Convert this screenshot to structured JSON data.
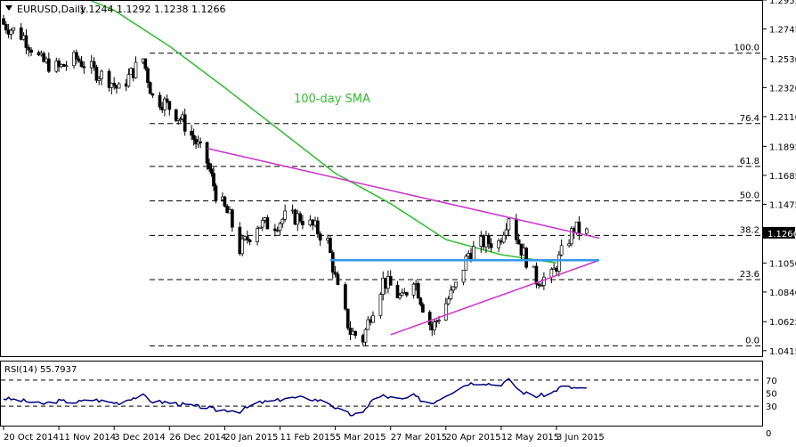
{
  "header": {
    "symbol": "EURUSD,Daily",
    "ohlc": "1.1244 1.1292 1.1238 1.1266"
  },
  "colors": {
    "bull": "#ffffff",
    "bear": "#000000",
    "sma": "#33bb33",
    "trendline": "#cc33cc",
    "support": "#3399ee",
    "fib": "#000000",
    "rsi": "#000080",
    "price_tag_bg": "#000000",
    "price_tag_fg": "#ffffff"
  },
  "chart_data": [
    {
      "type": "candlestick",
      "title": "EURUSD,Daily",
      "ylim": [
        1.0375,
        1.2955
      ],
      "y_ticks": [
        "1.2955",
        "1.2745",
        "1.2530",
        "1.2320",
        "1.2110",
        "1.1895",
        "1.1685",
        "1.1475",
        "1.1266",
        "1.1050",
        "1.0840",
        "1.0625",
        "1.0415"
      ],
      "x_ticks": [
        "20 Oct 2014",
        "11 Nov 2014",
        "3 Dec 2014",
        "26 Dec 2014",
        "20 Jan 2015",
        "11 Feb 2015",
        "5 Mar 2015",
        "27 Mar 2015",
        "20 Apr 2015",
        "12 May 2015",
        "3 Jun 2015"
      ],
      "current_price": "1.1266",
      "annotation": "100-day SMA",
      "close_path": [
        [
          "20 Oct 2014",
          1.278
        ],
        [
          "28 Oct 2014",
          1.269
        ],
        [
          "4 Nov 2014",
          1.251
        ],
        [
          "11 Nov 2014",
          1.246
        ],
        [
          "18 Nov 2014",
          1.253
        ],
        [
          "25 Nov 2014",
          1.244
        ],
        [
          "1 Dec 2014",
          1.238
        ],
        [
          "5 Dec 2014",
          1.23
        ],
        [
          "10 Dec 2014",
          1.242
        ],
        [
          "15 Dec 2014",
          1.253
        ],
        [
          "19 Dec 2014",
          1.225
        ],
        [
          "24 Dec 2014",
          1.221
        ],
        [
          "31 Dec 2014",
          1.21
        ],
        [
          "6 Jan 2015",
          1.195
        ],
        [
          "12 Jan 2015",
          1.178
        ],
        [
          "16 Jan 2015",
          1.156
        ],
        [
          "22 Jan 2015",
          1.138
        ],
        [
          "26 Jan 2015",
          1.115
        ],
        [
          "2 Feb 2015",
          1.133
        ],
        [
          "9 Feb 2015",
          1.133
        ],
        [
          "13 Feb 2015",
          1.138
        ],
        [
          "19 Feb 2015",
          1.138
        ],
        [
          "25 Feb 2015",
          1.13
        ],
        [
          "2 Mar 2015",
          1.12
        ],
        [
          "6 Mar 2015",
          1.085
        ],
        [
          "11 Mar 2015",
          1.055
        ],
        [
          "16 Mar 2015",
          1.05
        ],
        [
          "19 Mar 2015",
          1.068
        ],
        [
          "24 Mar 2015",
          1.092
        ],
        [
          "27 Mar 2015",
          1.088
        ],
        [
          "1 Apr 2015",
          1.078
        ],
        [
          "6 Apr 2015",
          1.095
        ],
        [
          "10 Apr 2015",
          1.074
        ],
        [
          "14 Apr 2015",
          1.057
        ],
        [
          "20 Apr 2015",
          1.076
        ],
        [
          "24 Apr 2015",
          1.088
        ],
        [
          "29 Apr 2015",
          1.112
        ],
        [
          "5 May 2015",
          1.12
        ],
        [
          "11 May 2015",
          1.12
        ],
        [
          "15 May 2015",
          1.14
        ],
        [
          "20 May 2015",
          1.115
        ],
        [
          "26 May 2015",
          1.093
        ],
        [
          "1 Jun 2015",
          1.095
        ],
        [
          "5 Jun 2015",
          1.112
        ],
        [
          "10 Jun 2015",
          1.13
        ],
        [
          "15 Jun 2015",
          1.1266
        ]
      ],
      "sma_100": [
        [
          "20 Oct 2014",
          1.323
        ],
        [
          "11 Nov 2014",
          1.305
        ],
        [
          "3 Dec 2014",
          1.288
        ],
        [
          "26 Dec 2014",
          1.262
        ],
        [
          "20 Jan 2015",
          1.232
        ],
        [
          "11 Feb 2015",
          1.201
        ],
        [
          "5 Mar 2015",
          1.17
        ],
        [
          "27 Mar 2015",
          1.148
        ],
        [
          "20 Apr 2015",
          1.122
        ],
        [
          "12 May 2015",
          1.111
        ],
        [
          "3 Jun 2015",
          1.105
        ]
      ],
      "fibonacci": [
        {
          "label": "100.0",
          "price": 1.257
        },
        {
          "label": "76.4",
          "price": 1.206
        },
        {
          "label": "61.8",
          "price": 1.175
        },
        {
          "label": "50.0",
          "price": 1.15
        },
        {
          "label": "38.2",
          "price": 1.125
        },
        {
          "label": "23.6",
          "price": 1.093
        },
        {
          "label": "0.0",
          "price": 1.045
        }
      ],
      "resistance_line": [
        [
          "12 Jan 2015",
          1.188
        ],
        [
          "20 Jun 2015",
          1.123
        ]
      ],
      "support_line": [
        [
          "27 Mar 2015",
          1.053
        ],
        [
          "20 Jun 2015",
          1.107
        ]
      ],
      "horizontal_support": {
        "from": "3 Mar 2015",
        "to": "20 Jun 2015",
        "price": 1.107
      }
    },
    {
      "type": "line",
      "title": "RSI(14) 55.7937",
      "ylim": [
        0,
        100
      ],
      "levels": [
        70,
        30
      ],
      "y_ticks": [
        "70",
        "50",
        "30",
        "0"
      ],
      "values": [
        [
          "20 Oct 2014",
          42
        ],
        [
          "28 Oct 2014",
          38
        ],
        [
          "4 Nov 2014",
          33
        ],
        [
          "11 Nov 2014",
          38
        ],
        [
          "18 Nov 2014",
          36
        ],
        [
          "25 Nov 2014",
          40
        ],
        [
          "1 Dec 2014",
          36
        ],
        [
          "5 Dec 2014",
          35
        ],
        [
          "10 Dec 2014",
          42
        ],
        [
          "15 Dec 2014",
          46
        ],
        [
          "19 Dec 2014",
          37
        ],
        [
          "24 Dec 2014",
          36
        ],
        [
          "31 Dec 2014",
          33
        ],
        [
          "6 Jan 2015",
          30
        ],
        [
          "12 Jan 2015",
          28
        ],
        [
          "16 Jan 2015",
          24
        ],
        [
          "22 Jan 2015",
          24
        ],
        [
          "26 Jan 2015",
          22
        ],
        [
          "2 Feb 2015",
          35
        ],
        [
          "9 Feb 2015",
          38
        ],
        [
          "13 Feb 2015",
          42
        ],
        [
          "19 Feb 2015",
          43
        ],
        [
          "25 Feb 2015",
          40
        ],
        [
          "2 Mar 2015",
          36
        ],
        [
          "6 Mar 2015",
          25
        ],
        [
          "11 Mar 2015",
          17
        ],
        [
          "16 Mar 2015",
          18
        ],
        [
          "19 Mar 2015",
          38
        ],
        [
          "24 Mar 2015",
          46
        ],
        [
          "27 Mar 2015",
          43
        ],
        [
          "1 Apr 2015",
          40
        ],
        [
          "6 Apr 2015",
          46
        ],
        [
          "10 Apr 2015",
          38
        ],
        [
          "14 Apr 2015",
          35
        ],
        [
          "20 Apr 2015",
          47
        ],
        [
          "24 Apr 2015",
          55
        ],
        [
          "29 Apr 2015",
          65
        ],
        [
          "5 May 2015",
          66
        ],
        [
          "11 May 2015",
          62
        ],
        [
          "15 May 2015",
          70
        ],
        [
          "20 May 2015",
          52
        ],
        [
          "26 May 2015",
          45
        ],
        [
          "1 Jun 2015",
          50
        ],
        [
          "5 Jun 2015",
          60
        ],
        [
          "10 Jun 2015",
          58
        ],
        [
          "15 Jun 2015",
          55.8
        ]
      ]
    }
  ]
}
